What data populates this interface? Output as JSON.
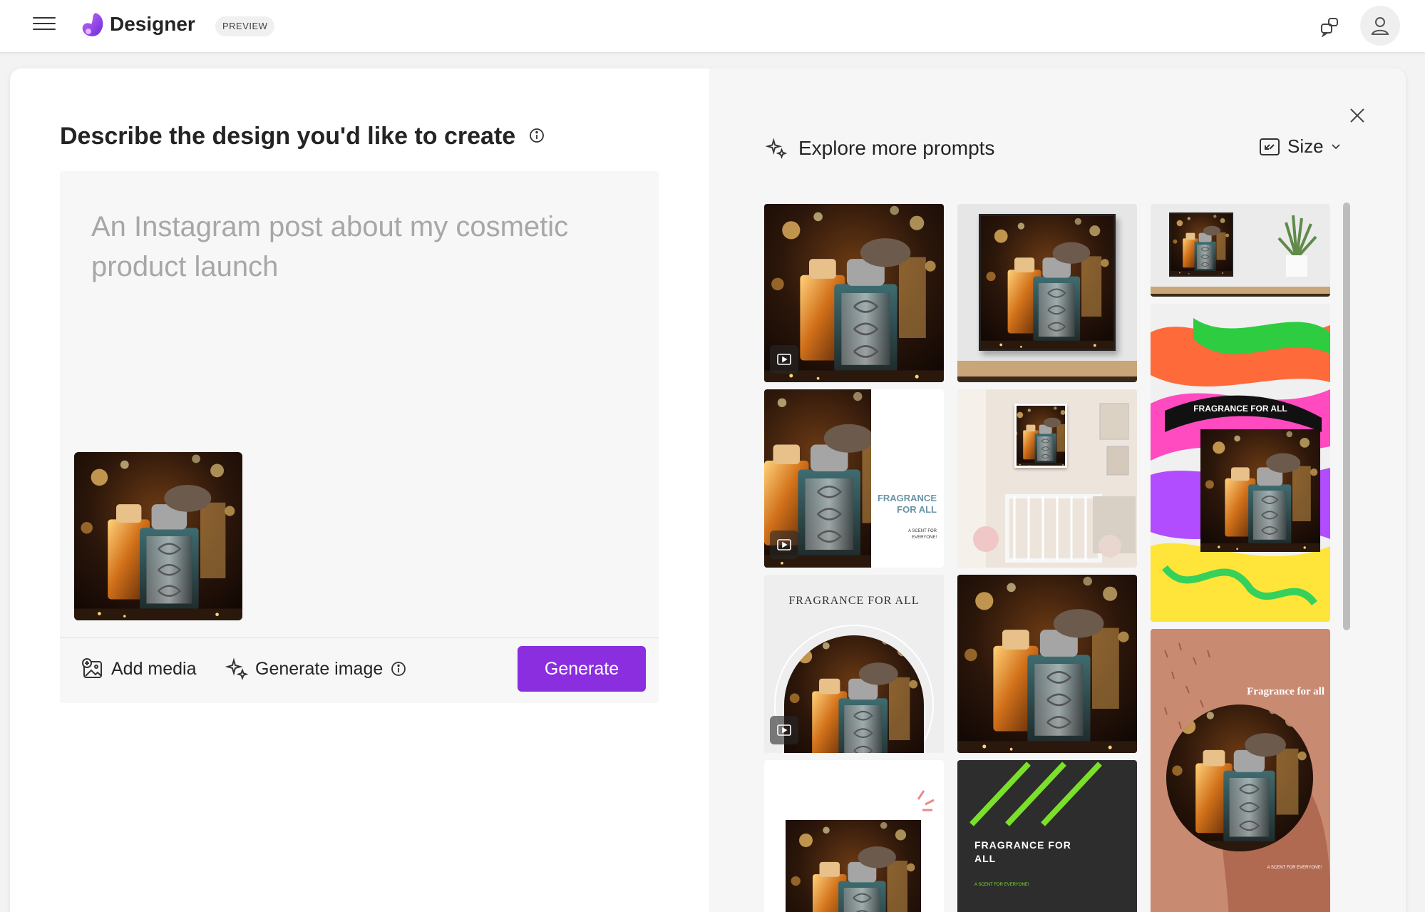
{
  "app": {
    "name": "Designer",
    "badge": "PREVIEW"
  },
  "header": {
    "menu_icon": "hamburger-menu-icon",
    "feedback_icon": "feedback-icon",
    "account_icon": "person-icon"
  },
  "compose": {
    "heading": "Describe the design you'd like to create",
    "prompt_placeholder": "An Instagram post about my cosmetic product launch",
    "prompt_value": "",
    "add_media_label": "Add media",
    "generate_image_label": "Generate image",
    "generate_button_label": "Generate"
  },
  "explore": {
    "label": "Explore more prompts",
    "size_label": "Size",
    "tiles": {
      "fragrance_for_all_caps": "FRAGRANCE FOR ALL",
      "fragrance_for_all_split": [
        "FRAGRANCE",
        "FOR ALL"
      ],
      "scent_for_everyone": [
        "A SCENT FOR",
        "EVERYONE!"
      ],
      "fragrance_for_all_title": "Fragrance for all",
      "fragrance_for_all_wrapped": [
        "FRAGRANCE FOR",
        "ALL"
      ],
      "scent_small": "A SCENT FOR EVERYONE!"
    }
  },
  "colors": {
    "accent": "#8a2ee0",
    "neon_green": "#7be02a",
    "terracotta": "#c98a72",
    "dark_tile": "#2d2d2d"
  }
}
